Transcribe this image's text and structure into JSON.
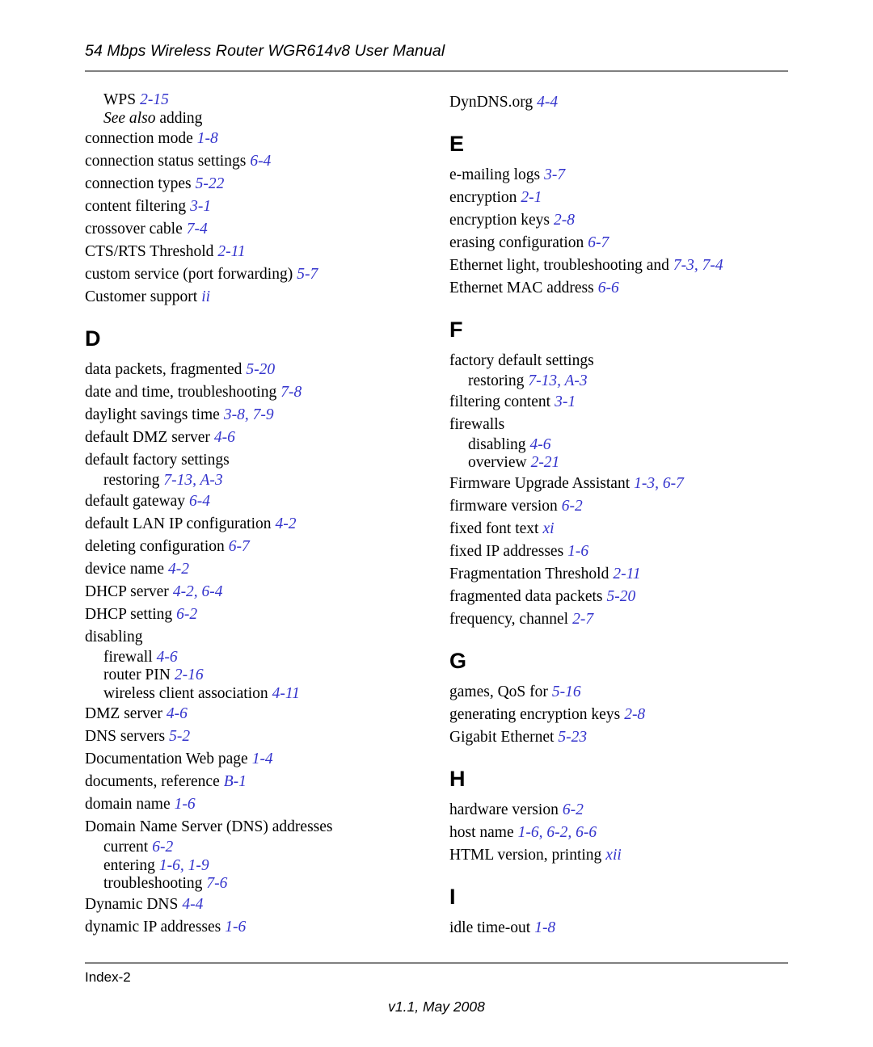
{
  "header": {
    "title": "54 Mbps Wireless Router WGR614v8 User Manual"
  },
  "footer": {
    "folio": "Index-2",
    "version": "v1.1, May 2008"
  },
  "colors": {
    "page_reference": "#3333cc",
    "rule": "#808080",
    "text": "#000000"
  },
  "left_column": {
    "entries": [
      {
        "kind": "sub",
        "term": "WPS",
        "ref": "2-15"
      },
      {
        "kind": "sub",
        "term_italic": "See also",
        "term": "adding",
        "ref": ""
      },
      {
        "kind": "main",
        "term": "connection mode",
        "ref": "1-8"
      },
      {
        "kind": "main",
        "term": "connection status settings",
        "ref": "6-4"
      },
      {
        "kind": "main",
        "term": "connection types",
        "ref": "5-22"
      },
      {
        "kind": "main",
        "term": "content filtering",
        "ref": "3-1"
      },
      {
        "kind": "main",
        "term": "crossover cable",
        "ref": "7-4"
      },
      {
        "kind": "main",
        "term": "CTS/RTS Threshold",
        "ref": "2-11"
      },
      {
        "kind": "main",
        "term": "custom service (port forwarding)",
        "ref": "5-7"
      },
      {
        "kind": "main",
        "term": "Customer support",
        "ref": "ii"
      },
      {
        "kind": "letter",
        "term": "D"
      },
      {
        "kind": "main",
        "term": "data packets, fragmented",
        "ref": "5-20"
      },
      {
        "kind": "main",
        "term": "date and time, troubleshooting",
        "ref": "7-8"
      },
      {
        "kind": "main",
        "term": "daylight savings time",
        "ref": "3-8, 7-9"
      },
      {
        "kind": "main",
        "term": "default DMZ server",
        "ref": "4-6"
      },
      {
        "kind": "main",
        "term": "default factory settings",
        "ref": ""
      },
      {
        "kind": "sub",
        "term": "restoring",
        "ref": "7-13, A-3"
      },
      {
        "kind": "main",
        "term": "default gateway",
        "ref": "6-4"
      },
      {
        "kind": "main",
        "term": "default LAN IP configuration",
        "ref": "4-2"
      },
      {
        "kind": "main",
        "term": "deleting configuration",
        "ref": "6-7"
      },
      {
        "kind": "main",
        "term": "device name",
        "ref": "4-2"
      },
      {
        "kind": "main",
        "term": "DHCP server",
        "ref": "4-2, 6-4"
      },
      {
        "kind": "main",
        "term": "DHCP setting",
        "ref": "6-2"
      },
      {
        "kind": "main",
        "term": "disabling",
        "ref": ""
      },
      {
        "kind": "sub",
        "term": "firewall",
        "ref": "4-6"
      },
      {
        "kind": "sub",
        "term": "router PIN",
        "ref": "2-16"
      },
      {
        "kind": "sub",
        "term": "wireless client association",
        "ref": "4-11"
      },
      {
        "kind": "main",
        "term": "DMZ server",
        "ref": "4-6"
      },
      {
        "kind": "main",
        "term": "DNS servers",
        "ref": "5-2"
      },
      {
        "kind": "main",
        "term": "Documentation Web page",
        "ref": "1-4"
      },
      {
        "kind": "main",
        "term": "documents, reference",
        "ref": "B-1"
      },
      {
        "kind": "main",
        "term": "domain name",
        "ref": "1-6"
      },
      {
        "kind": "main",
        "term": "Domain Name Server (DNS) addresses",
        "ref": ""
      },
      {
        "kind": "sub",
        "term": "current",
        "ref": "6-2"
      },
      {
        "kind": "sub",
        "term": "entering",
        "ref": "1-6, 1-9"
      },
      {
        "kind": "sub",
        "term": "troubleshooting",
        "ref": "7-6"
      },
      {
        "kind": "main",
        "term": "Dynamic DNS",
        "ref": "4-4"
      },
      {
        "kind": "main",
        "term": "dynamic IP addresses",
        "ref": "1-6"
      }
    ]
  },
  "right_column": {
    "entries": [
      {
        "kind": "main",
        "term": "DynDNS.org",
        "ref": "4-4"
      },
      {
        "kind": "letter",
        "term": "E"
      },
      {
        "kind": "main",
        "term": "e-mailing logs",
        "ref": "3-7"
      },
      {
        "kind": "main",
        "term": "encryption",
        "ref": "2-1"
      },
      {
        "kind": "main",
        "term": "encryption keys",
        "ref": "2-8"
      },
      {
        "kind": "main",
        "term": "erasing configuration",
        "ref": "6-7"
      },
      {
        "kind": "main",
        "term": "Ethernet light, troubleshooting and",
        "ref": "7-3, 7-4"
      },
      {
        "kind": "main",
        "term": "Ethernet MAC address",
        "ref": "6-6"
      },
      {
        "kind": "letter",
        "term": "F"
      },
      {
        "kind": "main",
        "term": "factory default settings",
        "ref": ""
      },
      {
        "kind": "sub",
        "term": "restoring",
        "ref": "7-13, A-3"
      },
      {
        "kind": "main",
        "term": "filtering content",
        "ref": "3-1"
      },
      {
        "kind": "main",
        "term": "firewalls",
        "ref": ""
      },
      {
        "kind": "sub",
        "term": "disabling",
        "ref": "4-6"
      },
      {
        "kind": "sub",
        "term": "overview",
        "ref": "2-21"
      },
      {
        "kind": "main",
        "term": "Firmware Upgrade Assistant",
        "ref": "1-3, 6-7"
      },
      {
        "kind": "main",
        "term": "firmware version",
        "ref": "6-2"
      },
      {
        "kind": "main",
        "term": "fixed font text",
        "ref": "xi"
      },
      {
        "kind": "main",
        "term": "fixed IP addresses",
        "ref": "1-6"
      },
      {
        "kind": "main",
        "term": "Fragmentation Threshold",
        "ref": "2-11"
      },
      {
        "kind": "main",
        "term": "fragmented data packets",
        "ref": "5-20"
      },
      {
        "kind": "main",
        "term": "frequency, channel",
        "ref": "2-7"
      },
      {
        "kind": "letter",
        "term": "G"
      },
      {
        "kind": "main",
        "term": "games, QoS for",
        "ref": "5-16"
      },
      {
        "kind": "main",
        "term": "generating encryption keys",
        "ref": "2-8"
      },
      {
        "kind": "main",
        "term": "Gigabit Ethernet",
        "ref": "5-23"
      },
      {
        "kind": "letter",
        "term": "H"
      },
      {
        "kind": "main",
        "term": "hardware version",
        "ref": "6-2"
      },
      {
        "kind": "main",
        "term": "host name",
        "ref": "1-6, 6-2, 6-6"
      },
      {
        "kind": "main",
        "term": "HTML version, printing",
        "ref": "xii"
      },
      {
        "kind": "letter",
        "term": "I"
      },
      {
        "kind": "main",
        "term": "idle time-out",
        "ref": "1-8"
      }
    ]
  }
}
